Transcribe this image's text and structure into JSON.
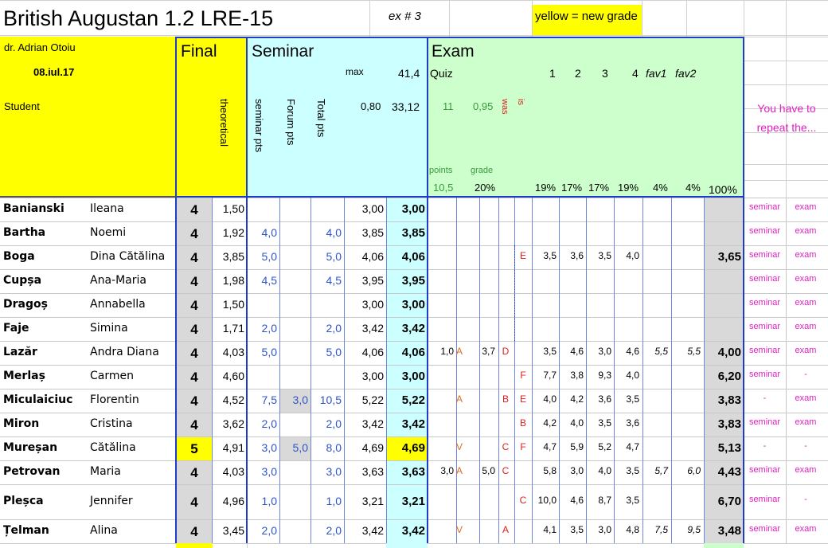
{
  "header": {
    "title": "British Augustan 1.2 LRE-15",
    "ex": "ex # 3",
    "legend": "yellow = new grade",
    "teacher": "dr. Adrian Otoiu",
    "date": "08.iul.17",
    "student": "Student",
    "final": "Final",
    "theoretical": "theoretical",
    "seminar": "Seminar",
    "seminar_pts": "seminar pts",
    "forum_pts": "Forum pts",
    "total_pts": "Total pts",
    "max": "max",
    "max_val": "41,4",
    "coef": "0,80",
    "coef_val": "33,12",
    "exam": "Exam",
    "quiz": "Quiz",
    "quiz_11": "11",
    "quiz_095": "0,95",
    "was": "was",
    "is": "is",
    "points": "points",
    "grade": "grade",
    "points_val": "10,5",
    "grade_pct": "20%",
    "cols": [
      "1",
      "2",
      "3",
      "4",
      "fav1",
      "fav2"
    ],
    "pcts": [
      "19%",
      "17%",
      "17%",
      "19%",
      "4%",
      "4%",
      "100%"
    ],
    "repeat": "You have to repeat the..."
  },
  "rows": [
    {
      "last": "Banianski",
      "first": "Ileana",
      "final": "4",
      "theo": "1,50",
      "sem": "",
      "forum": "",
      "total": "",
      "rel": "3,00",
      "grade": "3,00",
      "q1": "",
      "q1l": "",
      "q2": "",
      "q2l": "",
      "was": "",
      "is": "",
      "e1": "",
      "e2": "",
      "e3": "",
      "e4": "",
      "f1": "",
      "f2": "",
      "exam": "",
      "rs": "seminar",
      "re": "exam",
      "yellow": false
    },
    {
      "last": "Bartha",
      "first": "Noemi",
      "final": "4",
      "theo": "1,92",
      "sem": "4,0",
      "forum": "",
      "total": "4,0",
      "rel": "3,85",
      "grade": "3,85",
      "q1": "",
      "q1l": "",
      "q2": "",
      "q2l": "",
      "was": "",
      "is": "",
      "e1": "",
      "e2": "",
      "e3": "",
      "e4": "",
      "f1": "",
      "f2": "",
      "exam": "",
      "rs": "seminar",
      "re": "exam",
      "yellow": false
    },
    {
      "last": "Boga",
      "first": "Dina Cătălina",
      "final": "4",
      "theo": "3,85",
      "sem": "5,0",
      "forum": "",
      "total": "5,0",
      "rel": "4,06",
      "grade": "4,06",
      "q1": "",
      "q1l": "",
      "q2": "",
      "q2l": "",
      "was": "",
      "is": "E",
      "e1": "3,5",
      "e2": "3,6",
      "e3": "3,5",
      "e4": "4,0",
      "f1": "",
      "f2": "",
      "exam": "3,65",
      "rs": "seminar",
      "re": "exam",
      "yellow": false
    },
    {
      "last": "Cupșa",
      "first": "Ana-Maria",
      "final": "4",
      "theo": "1,98",
      "sem": "4,5",
      "forum": "",
      "total": "4,5",
      "rel": "3,95",
      "grade": "3,95",
      "q1": "",
      "q1l": "",
      "q2": "",
      "q2l": "",
      "was": "",
      "is": "",
      "e1": "",
      "e2": "",
      "e3": "",
      "e4": "",
      "f1": "",
      "f2": "",
      "exam": "",
      "rs": "seminar",
      "re": "exam",
      "yellow": false
    },
    {
      "last": "Dragoș",
      "first": "Annabella",
      "final": "4",
      "theo": "1,50",
      "sem": "",
      "forum": "",
      "total": "",
      "rel": "3,00",
      "grade": "3,00",
      "q1": "",
      "q1l": "",
      "q2": "",
      "q2l": "",
      "was": "",
      "is": "",
      "e1": "",
      "e2": "",
      "e3": "",
      "e4": "",
      "f1": "",
      "f2": "",
      "exam": "",
      "rs": "seminar",
      "re": "exam",
      "yellow": false
    },
    {
      "last": "Faje",
      "first": "Simina",
      "final": "4",
      "theo": "1,71",
      "sem": "2,0",
      "forum": "",
      "total": "2,0",
      "rel": "3,42",
      "grade": "3,42",
      "q1": "",
      "q1l": "",
      "q2": "",
      "q2l": "",
      "was": "",
      "is": "",
      "e1": "",
      "e2": "",
      "e3": "",
      "e4": "",
      "f1": "",
      "f2": "",
      "exam": "",
      "rs": "seminar",
      "re": "exam",
      "yellow": false
    },
    {
      "last": "Lazăr",
      "first": "Andra Diana",
      "final": "4",
      "theo": "4,03",
      "sem": "5,0",
      "forum": "",
      "total": "5,0",
      "rel": "4,06",
      "grade": "4,06",
      "q1": "1,0",
      "q1l": "A",
      "q2": "3,7",
      "q2l": "D",
      "was": "",
      "is": "",
      "e1": "3,5",
      "e2": "4,6",
      "e3": "3,0",
      "e4": "4,6",
      "f1": "5,5",
      "f2": "5,5",
      "exam": "4,00",
      "rs": "seminar",
      "re": "exam",
      "yellow": false
    },
    {
      "last": "Merlaș",
      "first": "Carmen",
      "final": "4",
      "theo": "4,60",
      "sem": "",
      "forum": "",
      "total": "",
      "rel": "3,00",
      "grade": "3,00",
      "q1": "",
      "q1l": "",
      "q2": "",
      "q2l": "",
      "was": "",
      "is": "F",
      "e1": "7,7",
      "e2": "3,8",
      "e3": "9,3",
      "e4": "4,0",
      "f1": "",
      "f2": "",
      "exam": "6,20",
      "rs": "seminar",
      "re": "-",
      "yellow": false
    },
    {
      "last": "Miculaiciuc",
      "first": "Florentin",
      "final": "4",
      "theo": "4,52",
      "sem": "7,5",
      "forum": "3,0",
      "total": "10,5",
      "rel": "5,22",
      "grade": "5,22",
      "q1": "",
      "q1l": "A",
      "q2": "",
      "q2l": "B",
      "was": "",
      "is": "E",
      "e1": "4,0",
      "e2": "4,2",
      "e3": "3,6",
      "e4": "3,5",
      "f1": "",
      "f2": "",
      "exam": "3,83",
      "rs": "-",
      "re": "exam",
      "yellow": false
    },
    {
      "last": "Miron",
      "first": "Cristina",
      "final": "4",
      "theo": "3,62",
      "sem": "2,0",
      "forum": "",
      "total": "2,0",
      "rel": "3,42",
      "grade": "3,42",
      "q1": "",
      "q1l": "",
      "q2": "",
      "q2l": "",
      "was": "",
      "is": "B",
      "e1": "4,2",
      "e2": "4,0",
      "e3": "3,5",
      "e4": "3,6",
      "f1": "",
      "f2": "",
      "exam": "3,83",
      "rs": "seminar",
      "re": "exam",
      "yellow": false
    },
    {
      "last": "Mureșan",
      "first": "Cătălina",
      "final": "5",
      "theo": "4,91",
      "sem": "3,0",
      "forum": "5,0",
      "total": "8,0",
      "rel": "4,69",
      "grade": "4,69",
      "q1": "",
      "q1l": "V",
      "q2": "",
      "q2l": "C",
      "was": "",
      "is": "F",
      "e1": "4,7",
      "e2": "5,9",
      "e3": "5,2",
      "e4": "4,7",
      "f1": "",
      "f2": "",
      "exam": "5,13",
      "rs": "-",
      "re": "-",
      "yellow": true
    },
    {
      "last": "Petrovan",
      "first": "Maria",
      "final": "4",
      "theo": "4,03",
      "sem": "3,0",
      "forum": "",
      "total": "3,0",
      "rel": "3,63",
      "grade": "3,63",
      "q1": "3,0",
      "q1l": "A",
      "q2": "5,0",
      "q2l": "C",
      "was": "",
      "is": "",
      "e1": "5,8",
      "e2": "3,0",
      "e3": "4,0",
      "e4": "3,5",
      "f1": "5,7",
      "f2": "6,0",
      "exam": "4,43",
      "rs": "seminar",
      "re": "exam",
      "yellow": false
    },
    {
      "last": "Pleșca",
      "first": "Jennifer",
      "final": "4",
      "theo": "4,96",
      "sem": "1,0",
      "forum": "",
      "total": "1,0",
      "rel": "3,21",
      "grade": "3,21",
      "q1": "",
      "q1l": "",
      "q2": "",
      "q2l": "",
      "was": "",
      "is": "C",
      "e1": "10,0",
      "e2": "4,6",
      "e3": "8,7",
      "e4": "3,5",
      "f1": "",
      "f2": "",
      "exam": "6,70",
      "rs": "seminar",
      "re": "-",
      "yellow": false
    },
    {
      "last": "Țelman",
      "first": "Alina",
      "final": "4",
      "theo": "3,45",
      "sem": "2,0",
      "forum": "",
      "total": "2,0",
      "rel": "3,42",
      "grade": "3,42",
      "q1": "",
      "q1l": "V",
      "q2": "",
      "q2l": "A",
      "was": "",
      "is": "",
      "e1": "4,1",
      "e2": "3,5",
      "e3": "3,0",
      "e4": "4,8",
      "f1": "7,5",
      "f2": "9,5",
      "exam": "3,48",
      "rs": "seminar",
      "re": "exam",
      "yellow": false
    }
  ],
  "colors": {
    "yellow": "#ffff00",
    "cyan": "#ccffff",
    "green": "#ccffcc",
    "blue_border": "#1f3cc7",
    "gray": "#d9d9d9"
  }
}
